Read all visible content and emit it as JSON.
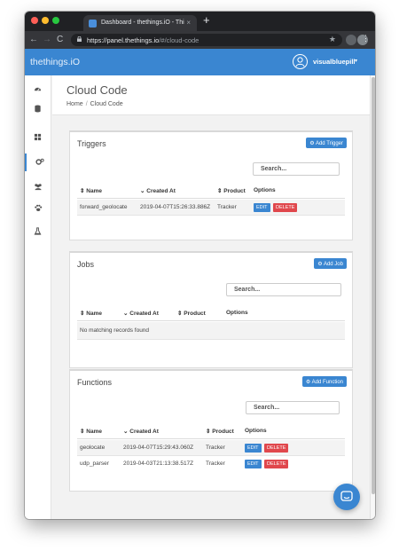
{
  "browser": {
    "tab_title": "Dashboard - thethings.iO - Thi",
    "tab_close": "×",
    "new_tab": "+",
    "url_host": "https://panel.thethings.io",
    "url_path": "/#/cloud-code",
    "menu": "⋮",
    "star": "★"
  },
  "app": {
    "logo": "thethings.iO",
    "username": "visualbluepill",
    "user_caret": "▾",
    "accent": "#3a86d1"
  },
  "header": {
    "title": "Cloud Code",
    "breadcrumb_home": "Home",
    "breadcrumb_sep": "/",
    "breadcrumb_current": "Cloud Code"
  },
  "sidebar": {
    "items": [
      {
        "icon": "dashboard-icon"
      },
      {
        "icon": "database-icon"
      },
      {
        "icon": "grid-icon"
      },
      {
        "icon": "cogs-icon",
        "active": true
      },
      {
        "icon": "users-icon"
      },
      {
        "icon": "paw-icon"
      },
      {
        "icon": "flask-icon"
      }
    ]
  },
  "triggers": {
    "title": "Triggers",
    "add_label": "Add Trigger",
    "search_placeholder": "Search...",
    "columns": [
      "Name",
      "Created At",
      "Product",
      "Options"
    ],
    "col_prefix": [
      "⇕",
      "⌄",
      "⇕",
      ""
    ],
    "rows": [
      {
        "name": "forward_geolocate",
        "created": "2019-04-07T15:26:33.886Z",
        "product": "Tracker"
      }
    ]
  },
  "jobs": {
    "title": "Jobs",
    "add_label": "Add Job",
    "search_placeholder": "Search...",
    "columns": [
      "Name",
      "Created At",
      "Product",
      "Options"
    ],
    "col_prefix": [
      "⇕",
      "⌄",
      "⇕",
      ""
    ],
    "empty_text": "No matching records found"
  },
  "functions": {
    "title": "Functions",
    "add_label": "Add Function",
    "search_placeholder": "Search...",
    "columns": [
      "Name",
      "Created At",
      "Product",
      "Options"
    ],
    "col_prefix": [
      "⇕",
      "⌄",
      "⇕",
      ""
    ],
    "rows": [
      {
        "name": "geolocate",
        "created": "2019-04-07T15:29:43.060Z",
        "product": "Tracker"
      },
      {
        "name": "udp_parser",
        "created": "2019-04-03T21:13:38.517Z",
        "product": "Tracker"
      }
    ]
  },
  "actions": {
    "edit": "EDIT",
    "delete": "DELETE"
  }
}
